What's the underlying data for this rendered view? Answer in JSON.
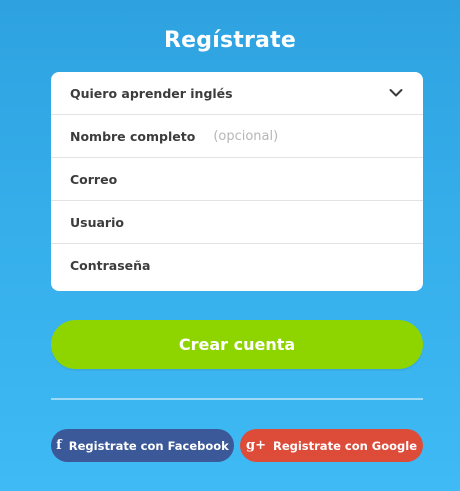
{
  "title": "Regístrate",
  "form": {
    "language_select": {
      "value": "Quiero aprender inglés",
      "icon": "chevron-down-icon"
    },
    "full_name": {
      "label": "Nombre completo",
      "placeholder": "(opcional)"
    },
    "email": {
      "label": "Correo"
    },
    "username": {
      "label": "Usuario"
    },
    "password": {
      "label": "Contraseña"
    }
  },
  "create_button_label": "Crear cuenta",
  "social": {
    "facebook": {
      "label": "Registrate con Facebook",
      "icon_glyph": "f",
      "color": "#3b5998"
    },
    "google": {
      "label": "Registrate con Google",
      "icon_glyph": "g+",
      "color": "#dd4b39"
    }
  },
  "colors": {
    "background": "#35aeea",
    "primary_button": "#8ed500",
    "card": "#ffffff"
  }
}
